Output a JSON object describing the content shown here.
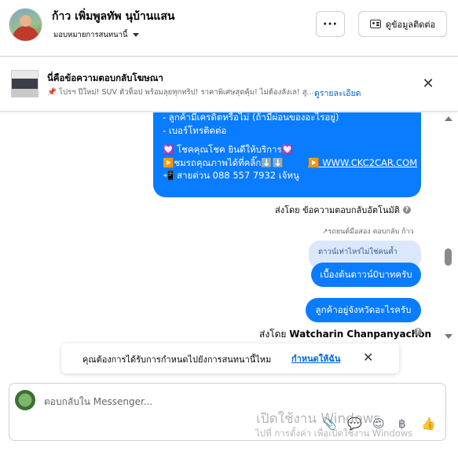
{
  "header": {
    "contact_name": "ก้าว เพิ่มพูลทัพ นุบ้านแสน",
    "assign_label": "มอบหมายการสนทนานี้",
    "more_label": "···",
    "view_contact_label": "ดูข้อมูลติดต่อ"
  },
  "ad_banner": {
    "title": "นี่คือข้อความตอบกลับโฆษณา",
    "pin_glyph": "📌",
    "snippet": "โปรฯ ปีใหม่! SUV ตัวท็อป พร้อมลุยทุกทริป! ราคาพิเศษสุดคุ้ม! ไม่ต้องลังเล! สู...",
    "details_link": "ดูรายละเอียด",
    "close_glyph": "✕"
  },
  "messages": {
    "auto_reply_lines": [
      "- ลูกค้ามีเครดิตหรือไม่ (ถ้ามีผ่อนของอะไรอยู่)",
      "- เบอร์โทรติดต่อ",
      "💟 โชคคุณโชค ยินดีให้บริการ💟",
      "▶️ชมรถคุณภาพได้ที่คลิ๊ก⬇️⬇️",
      "📲 สายด่วน 088 557 7932 เจ้หนู"
    ],
    "website_link": "▶️ WWW.CKC2CAR.COM",
    "auto_sent_by": "ส่งโดย ข้อความตอบกลับอัตโนมัติ",
    "reply_meta": "↗รถยนต์มือสอง ตอบกลับ ก้าว",
    "quoted_text": "ดาวน์เท่าไหร่ไม่ใช่คนค้ำ",
    "reply_1": "เบื้องต้นดาวน์0บาทครับ",
    "reply_2": "ลูกค้าอยู่จังหวัดอะไรครับ",
    "sent_by_prefix": "ส่งโดย",
    "sent_by_name": "Watcharin Chanpanyachon"
  },
  "toast": {
    "text": "คุณต้องการได้รับการกำหนดไปยังการสนทนานี้ไหม",
    "link": "กำหนดให้ฉัน",
    "close_glyph": "✕"
  },
  "composer": {
    "placeholder": "ตอบกลับใน Messenger...",
    "tools": [
      "📎",
      "💬",
      "☺",
      "฿",
      "👍"
    ]
  },
  "watermark": {
    "line1": "เปิดใช้งาน Windows",
    "line2": "ไปที่ การตั้งค่า เพื่อเปิดใช้งาน Windows"
  },
  "colors": {
    "bubble": "#0a7cff",
    "quoted_bg": "#dbe7fb",
    "link": "#0064d1"
  }
}
